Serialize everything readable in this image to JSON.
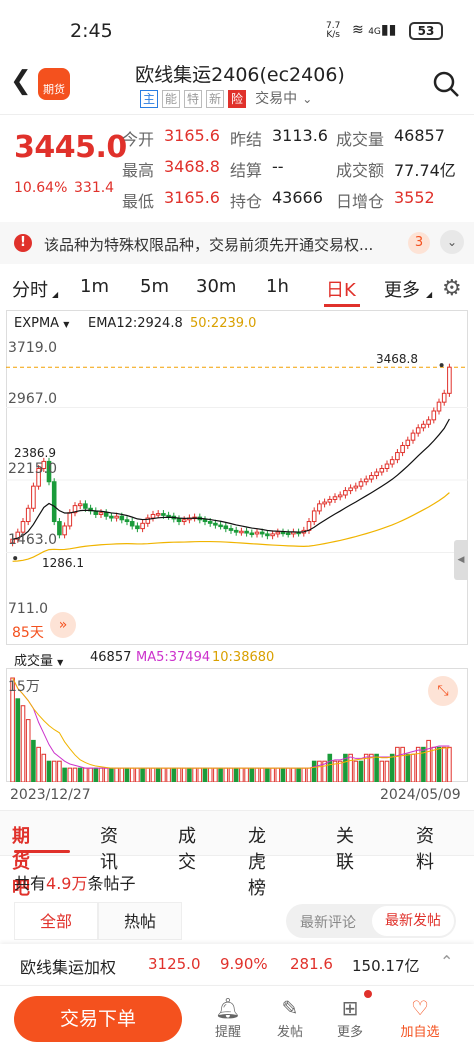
{
  "status_bar": {
    "time": "2:45",
    "net_speed": "7.7",
    "net_unit": "K/s",
    "net_type": "4G",
    "battery": "53"
  },
  "header": {
    "title": "欧线集运2406(ec2406)",
    "tags": [
      "主",
      "能",
      "特",
      "新",
      "险"
    ],
    "trade_status": "交易中",
    "logo_label": "期货"
  },
  "quote": {
    "last": "3445.0",
    "change_pct": "10.64%",
    "change": "331.4",
    "rows": [
      [
        {
          "label": "今开",
          "value": "3165.6",
          "color": "red"
        },
        {
          "label": "昨结",
          "value": "3113.6",
          "color": "normal"
        },
        {
          "label": "成交量",
          "value": "46857",
          "color": "normal"
        }
      ],
      [
        {
          "label": "最高",
          "value": "3468.8",
          "color": "red"
        },
        {
          "label": "结算",
          "value": "--",
          "color": "normal"
        },
        {
          "label": "成交额",
          "value": "77.74亿",
          "color": "normal"
        }
      ],
      [
        {
          "label": "最低",
          "value": "3165.6",
          "color": "red"
        },
        {
          "label": "持仓",
          "value": "43666",
          "color": "normal"
        },
        {
          "label": "日增仓",
          "value": "3552",
          "color": "red"
        }
      ]
    ]
  },
  "notice": {
    "text": "该品种为特殊权限品种，交易前须先开通交易权...",
    "count": "3"
  },
  "period_tabs": [
    {
      "label": "分时",
      "active": false
    },
    {
      "label": "1m",
      "active": false
    },
    {
      "label": "5m",
      "active": false
    },
    {
      "label": "30m",
      "active": false
    },
    {
      "label": "1h",
      "active": false
    },
    {
      "label": "日K",
      "active": true
    },
    {
      "label": "更多",
      "active": false
    }
  ],
  "kline": {
    "indicator": "EXPMA",
    "ema12_label": "EMA12:2924.8",
    "ema50_label": "50:2239.0",
    "y_ticks": [
      "3719.0",
      "2967.0",
      "2215.0",
      "1463.0",
      "711.0"
    ],
    "high_marker": "3468.8",
    "peak_marker": "2386.9",
    "low_marker": "1286.1",
    "days_label": "85天"
  },
  "volume": {
    "label": "成交量",
    "value": "46857",
    "ma5": "MA5:37494",
    "ma10": "10:38680",
    "y_tick": "15万",
    "start_date": "2023/12/27",
    "end_date": "2024/05/09"
  },
  "colors": {
    "up": "#e0312b",
    "down": "#1a9b3a",
    "accent": "#f4511e",
    "ema12": "#111111",
    "ema50": "#f0b400",
    "ma5": "#cc33cc"
  },
  "sub_tabs": [
    "期货吧",
    "资讯",
    "成交",
    "龙虎榜",
    "关联",
    "资料"
  ],
  "forum": {
    "count_prefix": "共有",
    "count": "4.9万",
    "count_suffix": "条帖子",
    "filters": [
      "全部",
      "热帖"
    ],
    "sorts": [
      "最新评论",
      "最新发帖"
    ]
  },
  "related": {
    "name": "欧线集运加权",
    "price": "3125.0",
    "pct": "9.90%",
    "change": "281.6",
    "amount": "150.17亿"
  },
  "bottom_nav": {
    "trade_button": "交易下单",
    "items": [
      {
        "label": "提醒",
        "icon": "bell-icon"
      },
      {
        "label": "发帖",
        "icon": "edit-icon"
      },
      {
        "label": "更多",
        "icon": "grid-icon"
      },
      {
        "label": "加自选",
        "icon": "heart-icon"
      }
    ]
  }
}
